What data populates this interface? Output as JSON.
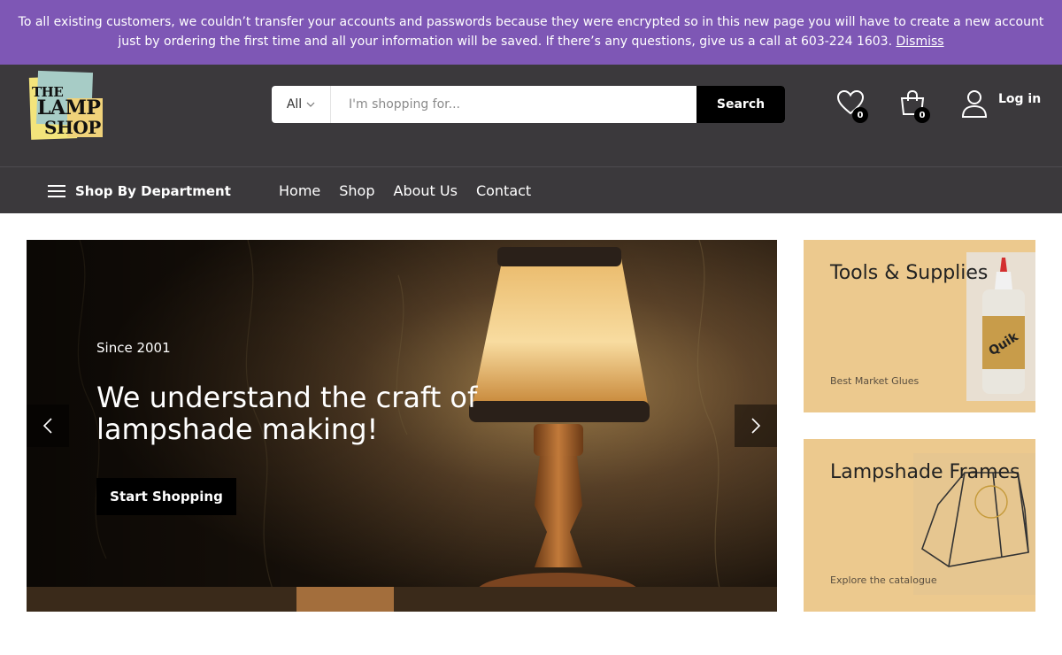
{
  "notice": {
    "text": "To all existing customers, we couldn’t transfer your accounts and passwords because they were encrypted so in this new page you will have to create a new account just by ordering the first time and all your information will be saved. If there’s any questions, give us a call at 603-224 1603.",
    "dismiss_label": "Dismiss",
    "bg_color": "#7e57b5"
  },
  "header": {
    "logo": {
      "line1": "THE",
      "line2": "LAMP",
      "line3": "SHOP"
    },
    "search": {
      "category_label": "All",
      "placeholder": "I'm shopping for...",
      "button_label": "Search"
    },
    "wishlist_count": "0",
    "cart_count": "0",
    "login_label": "Log in",
    "icons": [
      "heart-icon",
      "shopping-bag-icon",
      "user-icon"
    ]
  },
  "nav": {
    "department_label": "Shop By Department",
    "items": [
      {
        "label": "Home"
      },
      {
        "label": "Shop"
      },
      {
        "label": "About Us"
      },
      {
        "label": "Contact"
      }
    ]
  },
  "hero": {
    "eyebrow": "Since 2001",
    "headline": "We understand the craft of lampshade making!",
    "cta_label": "Start Shopping"
  },
  "promos": [
    {
      "title": "Tools & Supplies",
      "subtitle": "Best Market Glues",
      "bottle_label": "Quik"
    },
    {
      "title": "Lampshade Frames",
      "subtitle": "Explore the catalogue"
    }
  ],
  "colors": {
    "header_bg": "#3b393c",
    "promo_bg": "#ecc98e",
    "button_black": "#000000"
  }
}
